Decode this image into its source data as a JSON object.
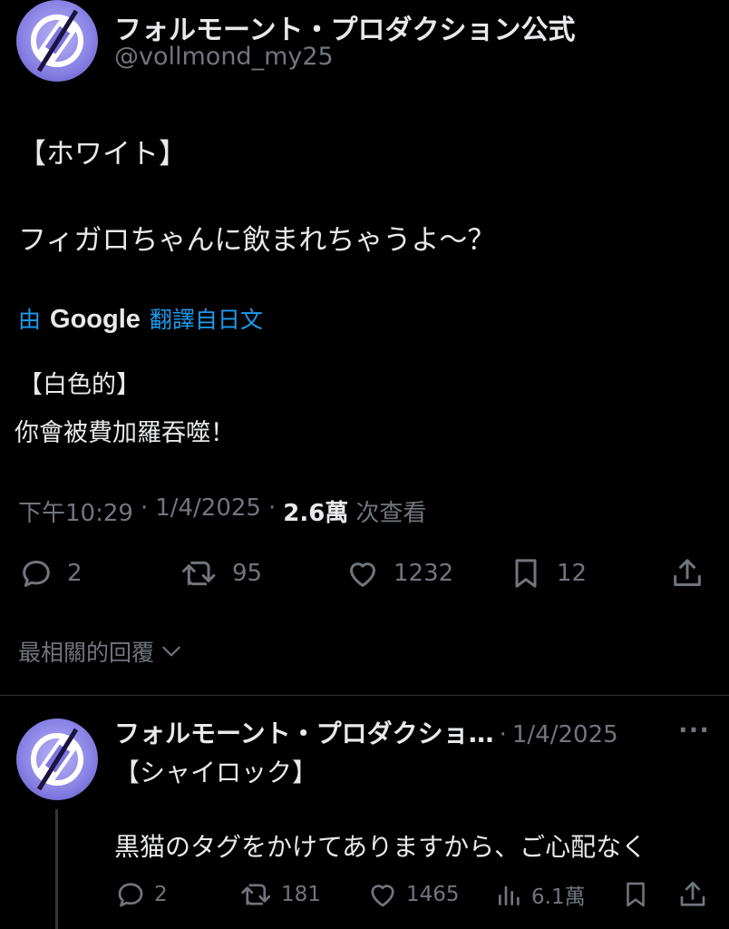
{
  "post": {
    "author_name": "フォルモーント・プロダクション公式",
    "handle": "@vollmond_my25",
    "text_line1": "【ホワイト】",
    "text_line2": "フィガロちゃんに飲まれちゃうよ～？",
    "translation_prefix": "由",
    "translation_brand": "Google",
    "translation_suffix": "翻譯自日文",
    "translated_line1": "【白色的】",
    "translated_line2": "你會被費加羅吞噬！",
    "time": "下午10:29",
    "date": "1/4/2025",
    "separator": "·",
    "views_count": "2.6萬",
    "views_label": "次查看",
    "actions": {
      "replies": "2",
      "reposts": "95",
      "likes": "1232",
      "bookmarks": "12"
    }
  },
  "replies_sort": {
    "label": "最相關的回覆",
    "icon": "chevron-down-icon"
  },
  "reply": {
    "author_name": "フォルモーント・プロダクショ…",
    "separator": "·",
    "date": "1/4/2025",
    "more": "···",
    "text_line1": "【シャイロック】",
    "text_line2": "黒猫のタグをかけてありますから、ご心配なく",
    "actions": {
      "replies": "2",
      "reposts": "181",
      "likes": "1465",
      "views": "6.1萬"
    }
  },
  "colors": {
    "background": "#000000",
    "text": "#e7e9ea",
    "secondary": "#71767b",
    "link": "#1d9bf0",
    "avatar": "#8c84e6"
  }
}
